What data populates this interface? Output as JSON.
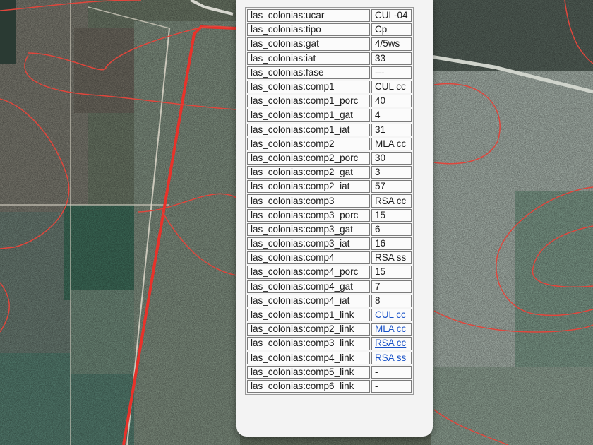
{
  "popup": {
    "rows": [
      {
        "key": "las_colonias:ucar",
        "value": "CUL-04"
      },
      {
        "key": "las_colonias:tipo",
        "value": "Cp"
      },
      {
        "key": "las_colonias:gat",
        "value": "4/5ws"
      },
      {
        "key": "las_colonias:iat",
        "value": "33"
      },
      {
        "key": "las_colonias:fase",
        "value": "---"
      },
      {
        "key": "las_colonias:comp1",
        "value": "CUL cc"
      },
      {
        "key": "las_colonias:comp1_porc",
        "value": "40"
      },
      {
        "key": "las_colonias:comp1_gat",
        "value": "4"
      },
      {
        "key": "las_colonias:comp1_iat",
        "value": "31"
      },
      {
        "key": "las_colonias:comp2",
        "value": "MLA cc"
      },
      {
        "key": "las_colonias:comp2_porc",
        "value": "30"
      },
      {
        "key": "las_colonias:comp2_gat",
        "value": "3"
      },
      {
        "key": "las_colonias:comp2_iat",
        "value": "57"
      },
      {
        "key": "las_colonias:comp3",
        "value": "RSA cc"
      },
      {
        "key": "las_colonias:comp3_porc",
        "value": "15"
      },
      {
        "key": "las_colonias:comp3_gat",
        "value": "6"
      },
      {
        "key": "las_colonias:comp3_iat",
        "value": "16"
      },
      {
        "key": "las_colonias:comp4",
        "value": "RSA ss"
      },
      {
        "key": "las_colonias:comp4_porc",
        "value": "15"
      },
      {
        "key": "las_colonias:comp4_gat",
        "value": "7"
      },
      {
        "key": "las_colonias:comp4_iat",
        "value": "8"
      },
      {
        "key": "las_colonias:comp1_link",
        "value": "CUL cc",
        "link": true
      },
      {
        "key": "las_colonias:comp2_link",
        "value": "MLA cc",
        "link": true
      },
      {
        "key": "las_colonias:comp3_link",
        "value": "RSA cc",
        "link": true
      },
      {
        "key": "las_colonias:comp4_link",
        "value": "RSA ss",
        "link": true
      },
      {
        "key": "las_colonias:comp5_link",
        "value": "-"
      },
      {
        "key": "las_colonias:comp6_link",
        "value": "-"
      }
    ]
  },
  "colors": {
    "boundary_line": "#e8322a",
    "link_text": "#1a53c8"
  }
}
